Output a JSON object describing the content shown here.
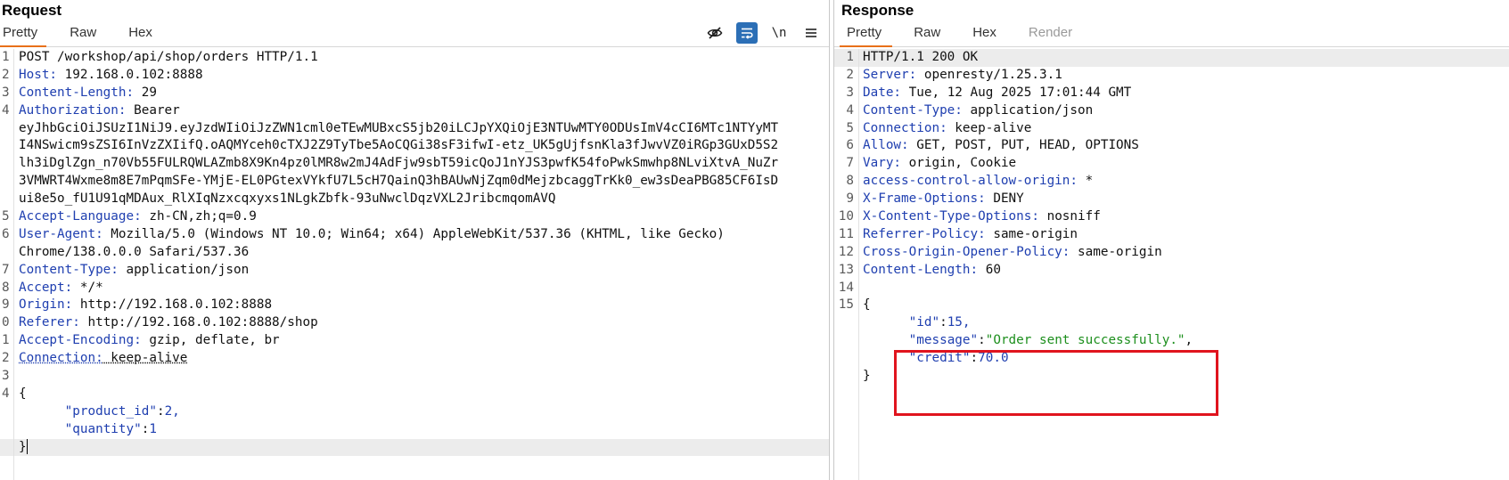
{
  "request": {
    "title": "Request",
    "tabs": [
      "Pretty",
      "Raw",
      "Hex"
    ],
    "toolbar": {
      "hide_icon": "eye-slash-icon",
      "wrap_icon": "word-wrap-icon",
      "newline_label": "\\n",
      "menu_icon": "hamburger-menu-icon"
    },
    "lines": [
      {
        "n": "1",
        "key": "",
        "text": "POST /workshop/api/shop/orders HTTP/1.1"
      },
      {
        "n": "2",
        "key": "Host:",
        "text": " 192.168.0.102:8888"
      },
      {
        "n": "3",
        "key": "Content-Length:",
        "text": " 29"
      },
      {
        "n": "4",
        "key": "Authorization:",
        "text": " Bearer"
      },
      {
        "n": "",
        "key": "",
        "text": "eyJhbGciOiJSUzI1NiJ9.eyJzdWIiOiJzZWN1cml0eTEwMUBxcS5jb20iLCJpYXQiOjE3NTUwMTY0ODUsImV4cCI6MTc1NTYyMT"
      },
      {
        "n": "",
        "key": "",
        "text": "I4NSwicm9sZSI6InVzZXIifQ.oAQMYceh0cTXJ2Z9TyTbe5AoCQGi38sF3ifwI-etz_UK5gUjfsnKla3fJwvVZ0iRGp3GUxD5S2"
      },
      {
        "n": "",
        "key": "",
        "text": "lh3iDglZgn_n70Vb55FULRQWLAZmb8X9Kn4pz0lMR8w2mJ4AdFjw9sbT59icQoJ1nYJS3pwfK54foPwkSmwhp8NLviXtvA_NuZr"
      },
      {
        "n": "",
        "key": "",
        "text": "3VMWRT4Wxme8m8E7mPqmSFe-YMjE-EL0PGtexVYkfU7L5cH7QainQ3hBAUwNjZqm0dMejzbcaggTrKk0_ew3sDeaPBG85CF6IsD"
      },
      {
        "n": "",
        "key": "",
        "text": "ui8e5o_fU1U91qMDAux_RlXIqNzxcqxyxs1NLgkZbfk-93uNwclDqzVXL2JribcmqomAVQ"
      },
      {
        "n": "5",
        "key": "Accept-Language:",
        "text": " zh-CN,zh;q=0.9"
      },
      {
        "n": "6",
        "key": "User-Agent:",
        "text": " Mozilla/5.0 (Windows NT 10.0; Win64; x64) AppleWebKit/537.36 (KHTML, like Gecko)"
      },
      {
        "n": "",
        "key": "",
        "text": "Chrome/138.0.0.0 Safari/537.36"
      },
      {
        "n": "7",
        "key": "Content-Type:",
        "text": " application/json"
      },
      {
        "n": "8",
        "key": "Accept:",
        "text": " */*"
      },
      {
        "n": "9",
        "key": "Origin:",
        "text": " http://192.168.0.102:8888"
      },
      {
        "n": "0",
        "key": "Referer:",
        "text": " http://192.168.0.102:8888/shop"
      },
      {
        "n": "1",
        "key": "Accept-Encoding:",
        "text": " gzip, deflate, br"
      },
      {
        "n": "2",
        "key": "Connection:",
        "text": " keep-alive",
        "dotted": true
      },
      {
        "n": "3",
        "key": "",
        "text": ""
      },
      {
        "n": "4",
        "key": "",
        "text": "{"
      },
      {
        "n": "",
        "key": "",
        "text": "",
        "json_key": "\"product_id\"",
        "json_val": "2,",
        "num": true
      },
      {
        "n": "",
        "key": "",
        "text": "",
        "json_key": "\"quantity\"",
        "json_val": "1",
        "num": true
      },
      {
        "n": "",
        "key": "",
        "text": "}",
        "cursor": true,
        "highlight": true
      }
    ]
  },
  "response": {
    "title": "Response",
    "tabs": [
      "Pretty",
      "Raw",
      "Hex",
      "Render"
    ],
    "lines": [
      {
        "n": "1",
        "key": "",
        "text": "HTTP/1.1 200 OK",
        "highlight": true
      },
      {
        "n": "2",
        "key": "Server:",
        "text": " openresty/1.25.3.1"
      },
      {
        "n": "3",
        "key": "Date:",
        "text": " Tue, 12 Aug 2025 17:01:44 GMT"
      },
      {
        "n": "4",
        "key": "Content-Type:",
        "text": " application/json"
      },
      {
        "n": "5",
        "key": "Connection:",
        "text": " keep-alive"
      },
      {
        "n": "6",
        "key": "Allow:",
        "text": " GET, POST, PUT, HEAD, OPTIONS"
      },
      {
        "n": "7",
        "key": "Vary:",
        "text": " origin, Cookie"
      },
      {
        "n": "8",
        "key": "access-control-allow-origin:",
        "text": " *"
      },
      {
        "n": "9",
        "key": "X-Frame-Options:",
        "text": " DENY"
      },
      {
        "n": "10",
        "key": "X-Content-Type-Options:",
        "text": " nosniff"
      },
      {
        "n": "11",
        "key": "Referrer-Policy:",
        "text": " same-origin"
      },
      {
        "n": "12",
        "key": "Cross-Origin-Opener-Policy:",
        "text": " same-origin"
      },
      {
        "n": "13",
        "key": "Content-Length:",
        "text": " 60"
      },
      {
        "n": "14",
        "key": "",
        "text": ""
      },
      {
        "n": "15",
        "key": "",
        "text": "{"
      },
      {
        "n": "",
        "key": "",
        "text": "",
        "json_key": "\"id\"",
        "json_val": "15,",
        "num": true
      },
      {
        "n": "",
        "key": "",
        "text": "",
        "json_key": "\"message\"",
        "json_val": "\"Order sent successfully.\"",
        "trail": ",",
        "num": false
      },
      {
        "n": "",
        "key": "",
        "text": "",
        "json_key": "\"credit\"",
        "json_val": "70.0",
        "num": true
      },
      {
        "n": "",
        "key": "",
        "text": "}"
      }
    ]
  },
  "colors": {
    "accent_tab": "#e8701a",
    "header_key": "#1f3fb0",
    "json_string": "#1d8f1d",
    "highlight_box": "#e0141e"
  }
}
